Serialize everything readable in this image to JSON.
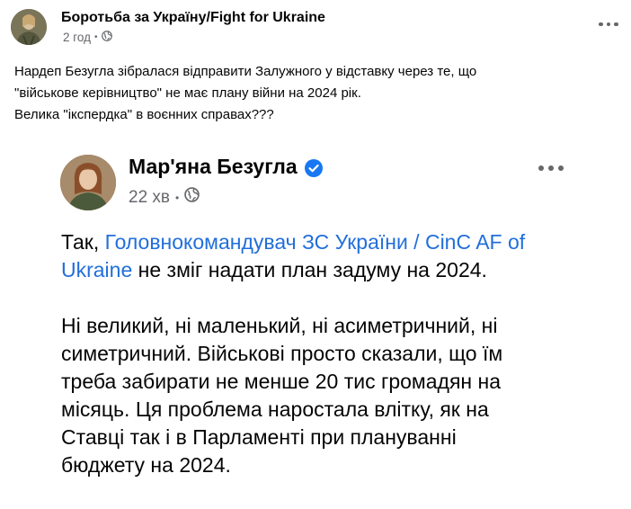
{
  "post": {
    "page_name": "Боротьба за Україну/Fight for Ukraine",
    "time": "2 год",
    "audience_icon": "globe-icon",
    "more_icon": "more-options-icon",
    "text_lines": [
      "Нардеп Безугла зібралася відправити Залужного у відставку через те, що",
      "\"військове керівництво\" не має плану війни на 2024 рік.",
      "Велика \"ікспердка\" в воєнних справах???"
    ]
  },
  "embedded": {
    "author_name": "Мар'яна Безугла",
    "verified_icon": "verified-badge-icon",
    "time": "22 хв",
    "audience_icon": "globe-icon",
    "para1": {
      "prefix": "Так, ",
      "mention_line1": "Головнокомандувач ЗС України / CinC AF of",
      "mention_line2": "Ukraine",
      "suffix": " не зміг надати план задуму на 2024."
    },
    "para2_lines": [
      "Ні великий, ні маленький, ні асиметричний, ні",
      "симетричний. Військові просто сказали, що їм",
      "треба забирати не менше 20 тис громадян на",
      "місяць. Ця проблема наростала влітку, як на",
      "Ставці так і в Парламенті при плануванні",
      "бюджету на 2024."
    ]
  },
  "colors": {
    "link": "#216fdb",
    "meta_text": "#65676b",
    "verified": "#1877f2"
  }
}
